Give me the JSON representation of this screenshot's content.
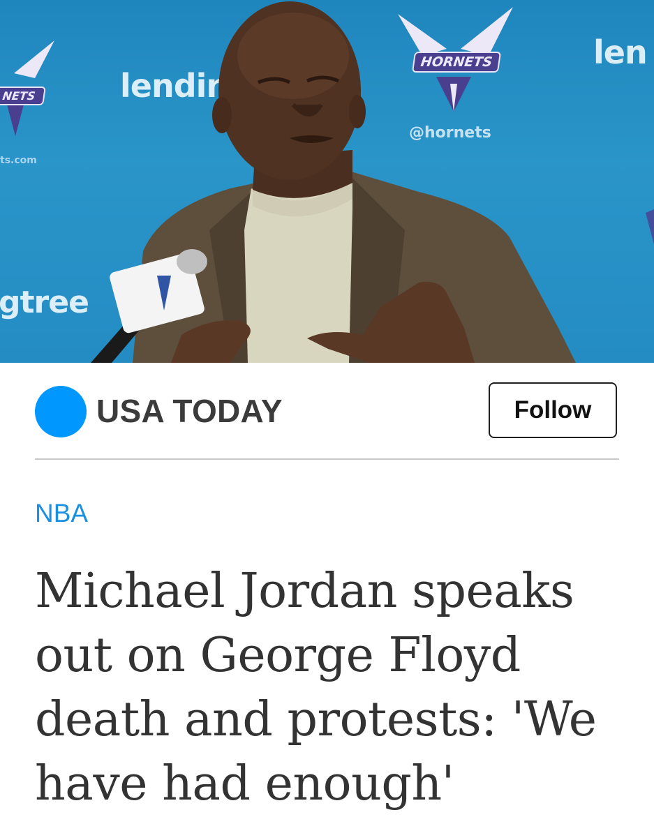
{
  "hero": {
    "backdrop_texts": [
      "lendin",
      "len",
      "gtree",
      "@hornets",
      "ts.com"
    ],
    "crest_labels": [
      "HORNETS",
      "NETS"
    ]
  },
  "publisher": {
    "name": "USA TODAY",
    "brand_color": "#0098fe",
    "follow_label": "Follow"
  },
  "article": {
    "section": "NBA",
    "section_color": "#1b8fe0",
    "headline": "Michael Jordan speaks out on George Floyd death and protests: 'We have had enough'"
  }
}
